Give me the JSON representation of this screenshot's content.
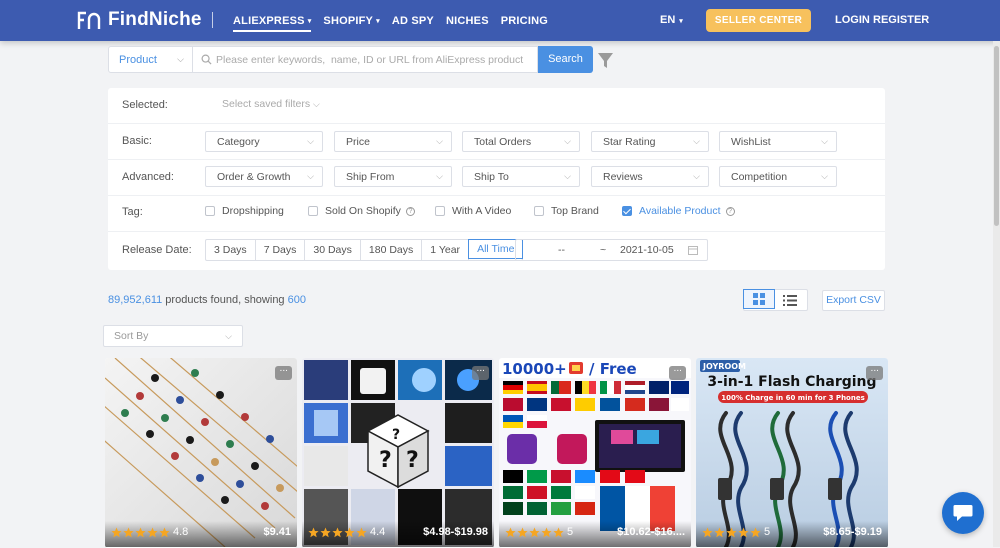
{
  "brand": {
    "logo_text": "FindNiche"
  },
  "nav": {
    "items": [
      {
        "label": "ALIEXPRESS",
        "caret": "▾",
        "active": true
      },
      {
        "label": "SHOPIFY",
        "caret": "▾"
      },
      {
        "label": "AD SPY",
        "caret": ""
      },
      {
        "label": "NICHES",
        "caret": ""
      },
      {
        "label": "PRICING",
        "caret": ""
      }
    ],
    "lang": "EN",
    "seller_center": "SELLER CENTER",
    "login": "LOGIN",
    "register": "REGISTER"
  },
  "search": {
    "type_label": "Product",
    "placeholder": "Please enter keywords,  name, ID or URL from AliExpress product",
    "button": "Search"
  },
  "filters": {
    "selected_label": "Selected:",
    "saved_filters": "Select saved filters",
    "basic_label": "Basic:",
    "basic": [
      "Category",
      "Price",
      "Total Orders",
      "Star Rating",
      "WishList"
    ],
    "advanced_label": "Advanced:",
    "advanced": [
      "Order & Growth",
      "Ship From",
      "Ship To",
      "Reviews",
      "Competition"
    ],
    "tag_label": "Tag:",
    "tags": [
      {
        "label": "Dropshipping",
        "checked": false,
        "help": false
      },
      {
        "label": "Sold On Shopify",
        "checked": false,
        "help": true
      },
      {
        "label": "With A Video",
        "checked": false,
        "help": false
      },
      {
        "label": "Top Brand",
        "checked": false,
        "help": false
      },
      {
        "label": "Available Product",
        "checked": true,
        "help": true
      }
    ],
    "release_label": "Release Date:",
    "release_options": [
      "3 Days",
      "7 Days",
      "30 Days",
      "180 Days",
      "1 Year",
      "All Time"
    ],
    "release_active": "All Time",
    "date_from": "--",
    "date_sep": "~",
    "date_to": "2021-10-05"
  },
  "results": {
    "count": "89,952,611",
    "found_text": " products found, showing ",
    "showing": "600",
    "export": "Export CSV",
    "sort_by": "Sort By"
  },
  "products": [
    {
      "rating": "4.8",
      "price": "$9.41",
      "image": "bracelets"
    },
    {
      "rating": "4.4",
      "price": "$4.98-$19.98",
      "image": "mystery-box"
    },
    {
      "rating": "5",
      "price": "$10.62-$16....",
      "image": "iptv",
      "banner": "10000+ 📺 / Free"
    },
    {
      "rating": "5",
      "price": "$8.65-$9.19",
      "image": "cables",
      "brand": "JOYROOM",
      "headline": "3-in-1 Flash Charging",
      "subline": "100% Charge in 60 min for 3 Phones"
    }
  ],
  "icons": {
    "star": "star-icon",
    "more": "more-icon",
    "chat": "chat-icon",
    "filter": "filter-funnel-icon"
  },
  "colors": {
    "header": "#3d5bb0",
    "accent": "#4a90e2",
    "seller": "#f7c15d",
    "star": "#f5a623"
  }
}
